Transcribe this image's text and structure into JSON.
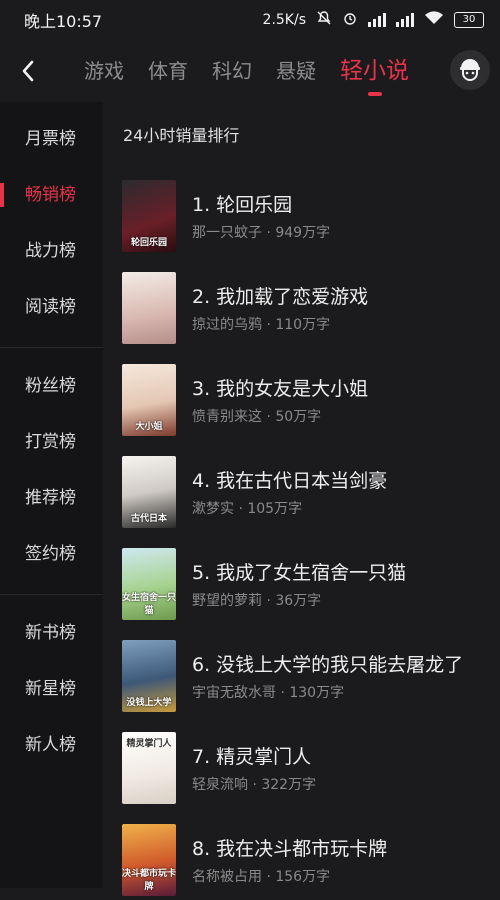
{
  "status_bar": {
    "time": "晚上10:57",
    "net_speed": "2.5K/s",
    "battery": "30"
  },
  "topnav": {
    "tabs": [
      "游戏",
      "体育",
      "科幻",
      "悬疑",
      "轻小说"
    ],
    "active_tab": "轻小说"
  },
  "sidebar": {
    "groups": [
      [
        "月票榜",
        "畅销榜",
        "战力榜",
        "阅读榜"
      ],
      [
        "粉丝榜",
        "打赏榜",
        "推荐榜",
        "签约榜"
      ],
      [
        "新书榜",
        "新星榜",
        "新人榜"
      ]
    ],
    "active": "畅销榜"
  },
  "list": {
    "title": "24小时销量排行",
    "books": [
      {
        "title": "1. 轮回乐园",
        "meta": "那一只蚊子 · 949万字",
        "cover_text": "轮回乐园",
        "cover_color": "#5a1d24"
      },
      {
        "title": "2. 我加载了恋爱游戏",
        "meta": "掠过的乌鸦 · 110万字",
        "cover_text": "",
        "cover_color": "#d9c8c0"
      },
      {
        "title": "3. 我的女友是大小姐",
        "meta": "愤青别来这 · 50万字",
        "cover_text": "大小姐",
        "cover_color": "#e8d8c8"
      },
      {
        "title": "4. 我在古代日本当剑豪",
        "meta": "漱梦实 · 105万字",
        "cover_text": "古代日本",
        "cover_color": "#f1eeea"
      },
      {
        "title": "5. 我成了女生宿舍一只猫",
        "meta": "野望的萝莉 · 36万字",
        "cover_text": "女生宿舍一只猫",
        "cover_color": "#9ccb8a"
      },
      {
        "title": "6. 没钱上大学的我只能去屠龙了",
        "meta": "宇宙无敌水哥 · 130万字",
        "cover_text": "没钱上大学",
        "cover_color": "#3f5a7a"
      },
      {
        "title": "7. 精灵掌门人",
        "meta": "轻泉流响 · 322万字",
        "cover_text": "精灵掌门人",
        "cover_color": "#f4f1ec"
      },
      {
        "title": "8. 我在决斗都市玩卡牌",
        "meta": "名称被占用 · 156万字",
        "cover_text": "决斗都市玩卡牌",
        "cover_color": "#c44f2a"
      }
    ]
  }
}
